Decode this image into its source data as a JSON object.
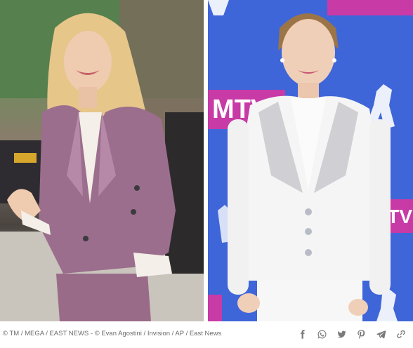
{
  "photos": {
    "left": {
      "icon": "photo-left"
    },
    "right": {
      "icon": "photo-right"
    }
  },
  "credit": {
    "text": "© TM / MEGA / EAST NEWS - © Evan Agostini / Invision / AP / East News"
  },
  "share": {
    "icons": [
      "facebook-icon",
      "whatsapp-icon",
      "twitter-icon",
      "pinterest-icon",
      "telegram-icon",
      "link-icon"
    ],
    "icon_color": "#7a7a7a"
  },
  "colors": {
    "left_suit": "#9c6e8d",
    "right_backdrop": "#3f66d8",
    "mtv_pink": "#c83aa6",
    "right_suit": "#f5f5f5"
  }
}
